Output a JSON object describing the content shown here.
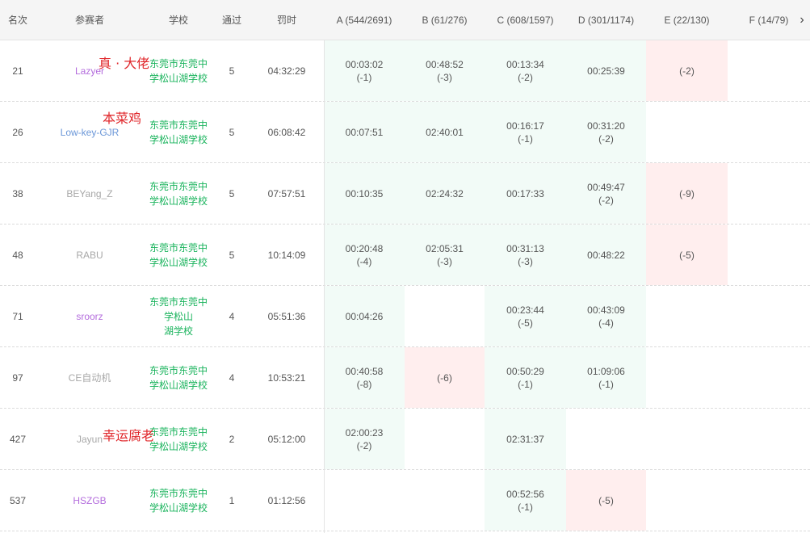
{
  "header": {
    "rank": "名次",
    "user": "参赛者",
    "school": "学校",
    "pass": "通过",
    "penalty": "罚时",
    "problems": [
      "A (544/2691)",
      "B (61/276)",
      "C (608/1597)",
      "D (301/1174)",
      "E (22/130)",
      "F (14/79)"
    ],
    "next_icon": "chevron-right-icon"
  },
  "rows": [
    {
      "rank": "21",
      "user": "Lazyer",
      "user_color": "purple",
      "school_l1": "东莞市东莞中",
      "school_l2": "学松山湖学校",
      "pass": "5",
      "penalty": "04:32:29",
      "A": {
        "t": "00:03:02",
        "p": "(-1)",
        "s": "ac"
      },
      "B": {
        "t": "00:48:52",
        "p": "(-3)",
        "s": "ac"
      },
      "C": {
        "t": "00:13:34",
        "p": "(-2)",
        "s": "ac"
      },
      "D": {
        "t": "00:25:39",
        "p": "",
        "s": "ac"
      },
      "E": {
        "t": "(-2)",
        "p": "",
        "s": "wa"
      },
      "F": {
        "t": "",
        "p": "",
        "s": ""
      }
    },
    {
      "rank": "26",
      "user": "Low-key-GJR",
      "user_color": "blue",
      "school_l1": "东莞市东莞中",
      "school_l2": "学松山湖学校",
      "pass": "5",
      "penalty": "06:08:42",
      "A": {
        "t": "00:07:51",
        "p": "",
        "s": "ac"
      },
      "B": {
        "t": "02:40:01",
        "p": "",
        "s": "ac"
      },
      "C": {
        "t": "00:16:17",
        "p": "(-1)",
        "s": "ac"
      },
      "D": {
        "t": "00:31:20",
        "p": "(-2)",
        "s": "ac"
      },
      "E": {
        "t": "",
        "p": "",
        "s": ""
      },
      "F": {
        "t": "",
        "p": "",
        "s": ""
      }
    },
    {
      "rank": "38",
      "user": "BEYang_Z",
      "user_color": "gray",
      "school_l1": "东莞市东莞中",
      "school_l2": "学松山湖学校",
      "pass": "5",
      "penalty": "07:57:51",
      "A": {
        "t": "00:10:35",
        "p": "",
        "s": "ac"
      },
      "B": {
        "t": "02:24:32",
        "p": "",
        "s": "ac"
      },
      "C": {
        "t": "00:17:33",
        "p": "",
        "s": "ac"
      },
      "D": {
        "t": "00:49:47",
        "p": "(-2)",
        "s": "ac"
      },
      "E": {
        "t": "(-9)",
        "p": "",
        "s": "wa"
      },
      "F": {
        "t": "",
        "p": "",
        "s": ""
      }
    },
    {
      "rank": "48",
      "user": "RABU",
      "user_color": "gray",
      "school_l1": "东莞市东莞中",
      "school_l2": "学松山湖学校",
      "pass": "5",
      "penalty": "10:14:09",
      "A": {
        "t": "00:20:48",
        "p": "(-4)",
        "s": "ac"
      },
      "B": {
        "t": "02:05:31",
        "p": "(-3)",
        "s": "ac"
      },
      "C": {
        "t": "00:31:13",
        "p": "(-3)",
        "s": "ac"
      },
      "D": {
        "t": "00:48:22",
        "p": "",
        "s": "ac"
      },
      "E": {
        "t": "(-5)",
        "p": "",
        "s": "wa"
      },
      "F": {
        "t": "",
        "p": "",
        "s": ""
      }
    },
    {
      "rank": "71",
      "user": "sroorz",
      "user_color": "purple",
      "school_l1": "东莞市东莞中学松山",
      "school_l2": "湖学校",
      "pass": "4",
      "penalty": "05:51:36",
      "A": {
        "t": "00:04:26",
        "p": "",
        "s": "ac"
      },
      "B": {
        "t": "",
        "p": "",
        "s": ""
      },
      "C": {
        "t": "00:23:44",
        "p": "(-5)",
        "s": "ac"
      },
      "D": {
        "t": "00:43:09",
        "p": "(-4)",
        "s": "ac"
      },
      "E": {
        "t": "",
        "p": "",
        "s": ""
      },
      "F": {
        "t": "",
        "p": "",
        "s": ""
      }
    },
    {
      "rank": "97",
      "user": "CE自动机",
      "user_color": "gray",
      "school_l1": "东莞市东莞中",
      "school_l2": "学松山湖学校",
      "pass": "4",
      "penalty": "10:53:21",
      "A": {
        "t": "00:40:58",
        "p": "(-8)",
        "s": "ac"
      },
      "B": {
        "t": "(-6)",
        "p": "",
        "s": "wa"
      },
      "C": {
        "t": "00:50:29",
        "p": "(-1)",
        "s": "ac"
      },
      "D": {
        "t": "01:09:06",
        "p": "(-1)",
        "s": "ac"
      },
      "E": {
        "t": "",
        "p": "",
        "s": ""
      },
      "F": {
        "t": "",
        "p": "",
        "s": ""
      }
    },
    {
      "rank": "427",
      "user": "Jayun",
      "user_color": "gray",
      "school_l1": "东莞市东莞中",
      "school_l2": "学松山湖学校",
      "pass": "2",
      "penalty": "05:12:00",
      "A": {
        "t": "02:00:23",
        "p": "(-2)",
        "s": "ac"
      },
      "B": {
        "t": "",
        "p": "",
        "s": ""
      },
      "C": {
        "t": "02:31:37",
        "p": "",
        "s": "ac"
      },
      "D": {
        "t": "",
        "p": "",
        "s": ""
      },
      "E": {
        "t": "",
        "p": "",
        "s": ""
      },
      "F": {
        "t": "",
        "p": "",
        "s": ""
      }
    },
    {
      "rank": "537",
      "user": "HSZGB",
      "user_color": "purple",
      "school_l1": "东莞市东莞中",
      "school_l2": "学松山湖学校",
      "pass": "1",
      "penalty": "01:12:56",
      "A": {
        "t": "",
        "p": "",
        "s": ""
      },
      "B": {
        "t": "",
        "p": "",
        "s": ""
      },
      "C": {
        "t": "00:52:56",
        "p": "(-1)",
        "s": "ac"
      },
      "D": {
        "t": "(-5)",
        "p": "",
        "s": "wa"
      },
      "E": {
        "t": "",
        "p": "",
        "s": ""
      },
      "F": {
        "t": "",
        "p": "",
        "s": ""
      }
    }
  ],
  "annotations": [
    "真 · 大佬",
    "本菜鸡",
    "幸运腐老"
  ],
  "colors": {
    "accepted_bg": "#f2fbf7",
    "wrong_bg": "#ffeeee",
    "school_green": "#19b35c",
    "user_purple": "#b46ddd",
    "user_blue": "#6b97d8",
    "user_gray": "#a8a8a8",
    "annotation_red": "#e0262a"
  }
}
